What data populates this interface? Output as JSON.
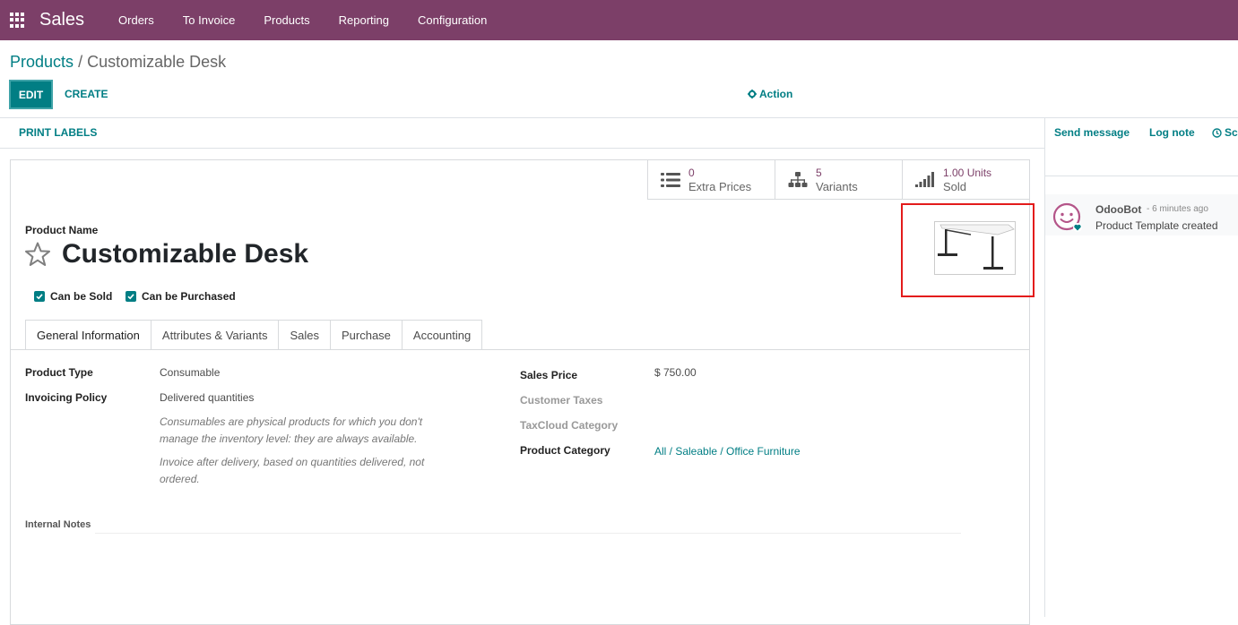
{
  "app": {
    "name": "Sales"
  },
  "nav": {
    "items": [
      {
        "label": "Orders"
      },
      {
        "label": "To Invoice"
      },
      {
        "label": "Products"
      },
      {
        "label": "Reporting"
      },
      {
        "label": "Configuration"
      }
    ]
  },
  "breadcrumb": {
    "parent": "Products",
    "separator": "/",
    "current": "Customizable Desk"
  },
  "toolbar": {
    "edit_label": "EDIT",
    "create_label": "CREATE",
    "action_label": "Action"
  },
  "statusbar": {
    "print_labels": "PRINT LABELS"
  },
  "smart_buttons": [
    {
      "value": "0",
      "label": "Extra Prices",
      "icon": "list-icon"
    },
    {
      "value": "5",
      "label": "Variants",
      "icon": "sitemap-icon"
    },
    {
      "value": "1.00 Units",
      "label": "Sold",
      "icon": "signal-icon"
    }
  ],
  "product": {
    "name_label": "Product Name",
    "name": "Customizable Desk",
    "can_be_sold": "Can be Sold",
    "can_be_purchased": "Can be Purchased"
  },
  "tabs": [
    {
      "label": "General Information",
      "active": true
    },
    {
      "label": "Attributes & Variants"
    },
    {
      "label": "Sales"
    },
    {
      "label": "Purchase"
    },
    {
      "label": "Accounting"
    }
  ],
  "general": {
    "product_type_label": "Product Type",
    "product_type": "Consumable",
    "invoicing_policy_label": "Invoicing Policy",
    "invoicing_policy": "Delivered quantities",
    "help_consumable": "Consumables are physical products for which you don't manage the inventory level: they are always available.",
    "help_invoice": "Invoice after delivery, based on quantities delivered, not ordered.",
    "sales_price_label": "Sales Price",
    "sales_price": "$ 750.00",
    "customer_taxes_label": "Customer Taxes",
    "taxcloud_label": "TaxCloud Category",
    "category_label": "Product Category",
    "category": "All / Saleable / Office Furniture",
    "internal_notes_label": "Internal Notes"
  },
  "chatter": {
    "send_message": "Send message",
    "log_note": "Log note",
    "schedule": "Sc",
    "message": {
      "author": "OdooBot",
      "date": "- 6 minutes ago",
      "body": "Product Template created"
    }
  },
  "colors": {
    "brand": "#7c3f68",
    "accent": "#017e84",
    "highlight": "#e31b1b"
  }
}
